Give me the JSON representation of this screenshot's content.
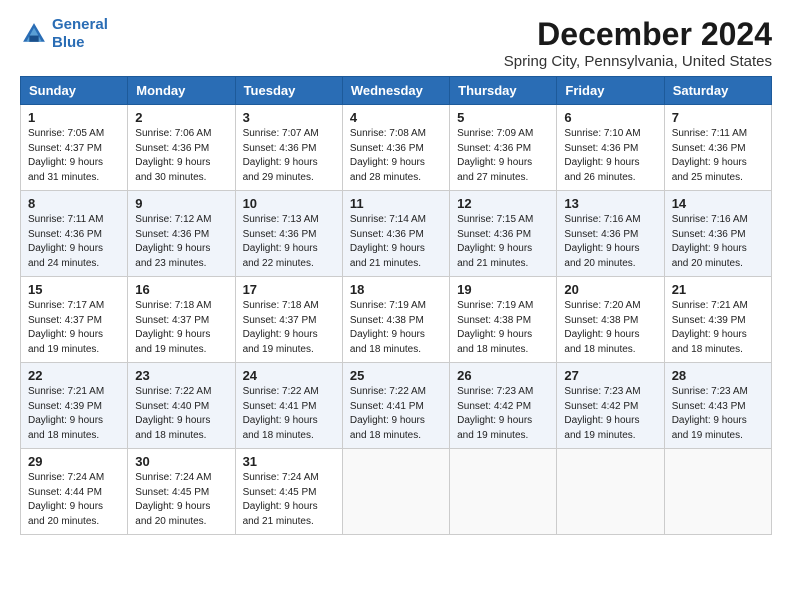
{
  "logo": {
    "line1": "General",
    "line2": "Blue"
  },
  "title": "December 2024",
  "location": "Spring City, Pennsylvania, United States",
  "days_of_week": [
    "Sunday",
    "Monday",
    "Tuesday",
    "Wednesday",
    "Thursday",
    "Friday",
    "Saturday"
  ],
  "weeks": [
    [
      {
        "day": "1",
        "info": "Sunrise: 7:05 AM\nSunset: 4:37 PM\nDaylight: 9 hours\nand 31 minutes."
      },
      {
        "day": "2",
        "info": "Sunrise: 7:06 AM\nSunset: 4:36 PM\nDaylight: 9 hours\nand 30 minutes."
      },
      {
        "day": "3",
        "info": "Sunrise: 7:07 AM\nSunset: 4:36 PM\nDaylight: 9 hours\nand 29 minutes."
      },
      {
        "day": "4",
        "info": "Sunrise: 7:08 AM\nSunset: 4:36 PM\nDaylight: 9 hours\nand 28 minutes."
      },
      {
        "day": "5",
        "info": "Sunrise: 7:09 AM\nSunset: 4:36 PM\nDaylight: 9 hours\nand 27 minutes."
      },
      {
        "day": "6",
        "info": "Sunrise: 7:10 AM\nSunset: 4:36 PM\nDaylight: 9 hours\nand 26 minutes."
      },
      {
        "day": "7",
        "info": "Sunrise: 7:11 AM\nSunset: 4:36 PM\nDaylight: 9 hours\nand 25 minutes."
      }
    ],
    [
      {
        "day": "8",
        "info": "Sunrise: 7:11 AM\nSunset: 4:36 PM\nDaylight: 9 hours\nand 24 minutes."
      },
      {
        "day": "9",
        "info": "Sunrise: 7:12 AM\nSunset: 4:36 PM\nDaylight: 9 hours\nand 23 minutes."
      },
      {
        "day": "10",
        "info": "Sunrise: 7:13 AM\nSunset: 4:36 PM\nDaylight: 9 hours\nand 22 minutes."
      },
      {
        "day": "11",
        "info": "Sunrise: 7:14 AM\nSunset: 4:36 PM\nDaylight: 9 hours\nand 21 minutes."
      },
      {
        "day": "12",
        "info": "Sunrise: 7:15 AM\nSunset: 4:36 PM\nDaylight: 9 hours\nand 21 minutes."
      },
      {
        "day": "13",
        "info": "Sunrise: 7:16 AM\nSunset: 4:36 PM\nDaylight: 9 hours\nand 20 minutes."
      },
      {
        "day": "14",
        "info": "Sunrise: 7:16 AM\nSunset: 4:36 PM\nDaylight: 9 hours\nand 20 minutes."
      }
    ],
    [
      {
        "day": "15",
        "info": "Sunrise: 7:17 AM\nSunset: 4:37 PM\nDaylight: 9 hours\nand 19 minutes."
      },
      {
        "day": "16",
        "info": "Sunrise: 7:18 AM\nSunset: 4:37 PM\nDaylight: 9 hours\nand 19 minutes."
      },
      {
        "day": "17",
        "info": "Sunrise: 7:18 AM\nSunset: 4:37 PM\nDaylight: 9 hours\nand 19 minutes."
      },
      {
        "day": "18",
        "info": "Sunrise: 7:19 AM\nSunset: 4:38 PM\nDaylight: 9 hours\nand 18 minutes."
      },
      {
        "day": "19",
        "info": "Sunrise: 7:19 AM\nSunset: 4:38 PM\nDaylight: 9 hours\nand 18 minutes."
      },
      {
        "day": "20",
        "info": "Sunrise: 7:20 AM\nSunset: 4:38 PM\nDaylight: 9 hours\nand 18 minutes."
      },
      {
        "day": "21",
        "info": "Sunrise: 7:21 AM\nSunset: 4:39 PM\nDaylight: 9 hours\nand 18 minutes."
      }
    ],
    [
      {
        "day": "22",
        "info": "Sunrise: 7:21 AM\nSunset: 4:39 PM\nDaylight: 9 hours\nand 18 minutes."
      },
      {
        "day": "23",
        "info": "Sunrise: 7:22 AM\nSunset: 4:40 PM\nDaylight: 9 hours\nand 18 minutes."
      },
      {
        "day": "24",
        "info": "Sunrise: 7:22 AM\nSunset: 4:41 PM\nDaylight: 9 hours\nand 18 minutes."
      },
      {
        "day": "25",
        "info": "Sunrise: 7:22 AM\nSunset: 4:41 PM\nDaylight: 9 hours\nand 18 minutes."
      },
      {
        "day": "26",
        "info": "Sunrise: 7:23 AM\nSunset: 4:42 PM\nDaylight: 9 hours\nand 19 minutes."
      },
      {
        "day": "27",
        "info": "Sunrise: 7:23 AM\nSunset: 4:42 PM\nDaylight: 9 hours\nand 19 minutes."
      },
      {
        "day": "28",
        "info": "Sunrise: 7:23 AM\nSunset: 4:43 PM\nDaylight: 9 hours\nand 19 minutes."
      }
    ],
    [
      {
        "day": "29",
        "info": "Sunrise: 7:24 AM\nSunset: 4:44 PM\nDaylight: 9 hours\nand 20 minutes."
      },
      {
        "day": "30",
        "info": "Sunrise: 7:24 AM\nSunset: 4:45 PM\nDaylight: 9 hours\nand 20 minutes."
      },
      {
        "day": "31",
        "info": "Sunrise: 7:24 AM\nSunset: 4:45 PM\nDaylight: 9 hours\nand 21 minutes."
      },
      {
        "day": "",
        "info": ""
      },
      {
        "day": "",
        "info": ""
      },
      {
        "day": "",
        "info": ""
      },
      {
        "day": "",
        "info": ""
      }
    ]
  ]
}
